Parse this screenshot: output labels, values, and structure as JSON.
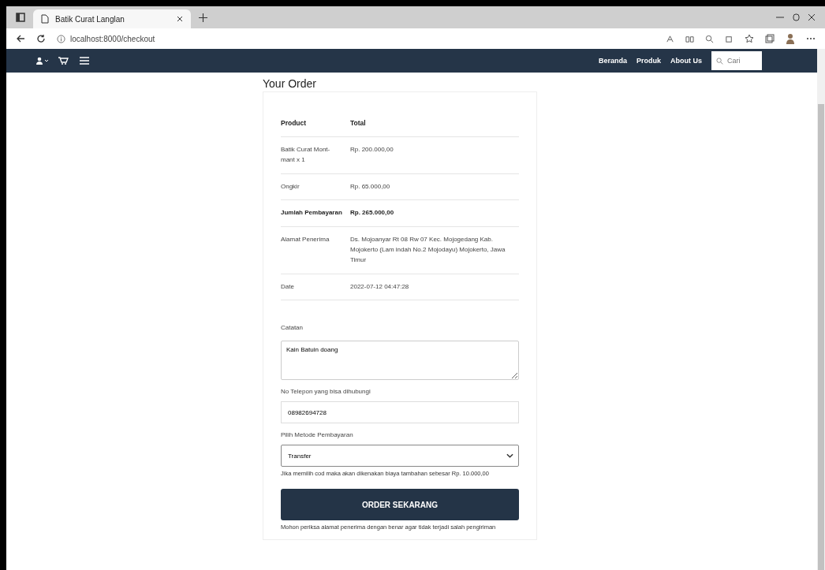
{
  "browser": {
    "tab_title": "Batik Curat Langlan",
    "url": "localhost:8000/checkout"
  },
  "navbar": {
    "links": [
      {
        "label": "Beranda"
      },
      {
        "label": "Produk"
      },
      {
        "label": "About Us"
      }
    ],
    "search": {
      "placeholder": "Cari"
    }
  },
  "order": {
    "title": "Your Order",
    "columns": [
      "Product",
      "Total"
    ],
    "rows": [
      {
        "label": "Batik Curat Mont-mant  x 1",
        "value": "Rp. 200.000,00",
        "bold": false
      },
      {
        "label": "Ongkir",
        "value": "Rp. 65.000,00",
        "bold": false
      },
      {
        "label": "Jumlah Pembayaran",
        "value": "Rp. 265.000,00",
        "bold": true
      },
      {
        "label": "Alamat Penerima",
        "value": "Ds. Mojoanyar Rt 08 Rw 07 Kec. Mojogedang Kab. Mojokerto (Lam indah No.2 Mojodayu) Mojokerto, Jawa Timur",
        "bold": false
      },
      {
        "label": "Date",
        "value": "2022-07-12 04:47:28",
        "bold": false
      }
    ]
  },
  "form": {
    "note": {
      "label": "Catatan",
      "value": "Kain Batuin doang"
    },
    "phone": {
      "label": "No Telepon yang bisa dihubungi",
      "value": "08982694728"
    },
    "payment": {
      "label": "Pilih Metode Pembayaran",
      "value": "Transfer",
      "hint": "Jika memilih cod maka akan dikenakan biaya tambahan sebesar Rp. 10.000,00"
    },
    "submit": "ORDER SEKARANG",
    "footnote": "Mohon periksa alamat penerima dengan benar agar tidak terjadi salah pengiriman"
  }
}
